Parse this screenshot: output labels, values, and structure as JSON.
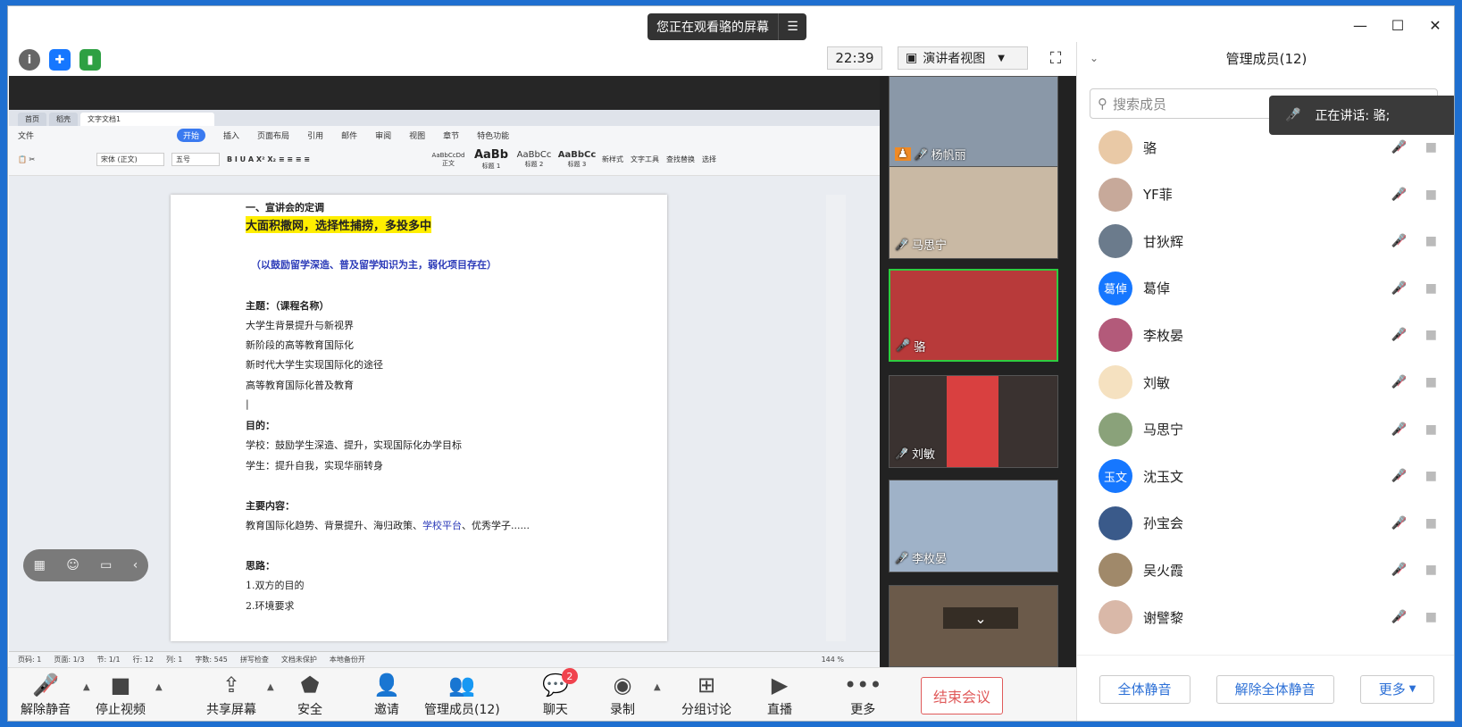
{
  "banner": {
    "text": "您正在观看骆的屏幕"
  },
  "topbar": {
    "clock": "22:39",
    "view_label": "演讲者视图"
  },
  "document": {
    "tabs": [
      "首页",
      "稻壳",
      "文字文档1"
    ],
    "menu": [
      "文件",
      "开始",
      "插入",
      "页面布局",
      "引用",
      "邮件",
      "审阅",
      "视图",
      "章节",
      "特色功能"
    ],
    "ribbon": {
      "font": "宋体 (正文)",
      "size": "五号",
      "styles": [
        {
          "preview": "AaBbCcDd",
          "label": "正文"
        },
        {
          "preview": "AaBb",
          "label": "标题 1"
        },
        {
          "preview": "AaBbCc",
          "label": "标题 2"
        },
        {
          "preview": "AaBbCc",
          "label": "标题 3"
        }
      ],
      "newstyle": "新样式",
      "texttools": "文字工具",
      "findreplace": "查找替换",
      "select": "选择"
    },
    "lines": {
      "l1": "一、宣讲会的定调",
      "l2": "大面积撒网，选择性捕捞，多投多中",
      "l3": "（以鼓励留学深造、普及留学知识为主，弱化项目存在）",
      "l4": "主题：（课程名称）",
      "l5": "大学生背景提升与新视界",
      "l6": "新阶段的高等教育国际化",
      "l7": "新时代大学生实现国际化的途径",
      "l8": "高等教育国际化普及教育",
      "l9": "目的：",
      "l10": "学校：鼓励学生深造、提升，实现国际化办学目标",
      "l11": "学生：提升自我，实现华丽转身",
      "l12": "主要内容：",
      "l13a": "教育国际化趋势、背景提升、海归政策、",
      "l13b": "学校平台",
      "l13c": "、优秀学子......",
      "l14": "思路：",
      "l15": "1.双方的目的",
      "l16": "2.环境要求"
    },
    "status": [
      "页码: 1",
      "页面: 1/3",
      "节: 1/1",
      "行: 12",
      "列: 1",
      "字数: 545",
      "拼写检查",
      "文档未保护",
      "本地备份开"
    ],
    "zoom": "144 %"
  },
  "videos": [
    {
      "name": "杨帆丽",
      "bg": "#8a98a8"
    },
    {
      "name": "马思宁",
      "bg": "#c9b9a4"
    },
    {
      "name": "骆",
      "bg": "#b83a3a"
    },
    {
      "name": "刘敏",
      "bg": "#3a3230"
    },
    {
      "name": "李枚晏",
      "bg": "#9fb2c8"
    },
    {
      "name": "",
      "bg": "#6b5a4a"
    }
  ],
  "panel": {
    "title": "管理成员(12)",
    "search_placeholder": "搜索成员",
    "speaking": "正在讲话: 骆;",
    "members": [
      {
        "name": "骆",
        "avatar": "",
        "color": "#e9c9a6"
      },
      {
        "name": "YF菲",
        "avatar": "",
        "color": "#c7a99a"
      },
      {
        "name": "甘狄辉",
        "avatar": "",
        "color": "#6b7b8c"
      },
      {
        "name": "葛倬",
        "avatar": "葛倬",
        "color": "#1677ff"
      },
      {
        "name": "李枚晏",
        "avatar": "",
        "color": "#b35a7a"
      },
      {
        "name": "刘敏",
        "avatar": "",
        "color": "#f5e1c0"
      },
      {
        "name": "马思宁",
        "avatar": "",
        "color": "#8aa27a"
      },
      {
        "name": "沈玉文",
        "avatar": "玉文",
        "color": "#1677ff"
      },
      {
        "name": "孙宝会",
        "avatar": "",
        "color": "#3a5a8a"
      },
      {
        "name": "吴火霞",
        "avatar": "",
        "color": "#a0896a"
      },
      {
        "name": "谢譬黎",
        "avatar": "",
        "color": "#d9b8a8"
      }
    ],
    "buttons": {
      "mute_all": "全体静音",
      "unmute_all": "解除全体静音",
      "more": "更多"
    }
  },
  "bottombar": {
    "unmute": "解除静音",
    "stop_video": "停止视频",
    "share": "共享屏幕",
    "security": "安全",
    "invite": "邀请",
    "members": "管理成员(12)",
    "chat": "聊天",
    "chat_badge": "2",
    "record": "录制",
    "breakout": "分组讨论",
    "live": "直播",
    "more": "更多",
    "end": "结束会议"
  }
}
